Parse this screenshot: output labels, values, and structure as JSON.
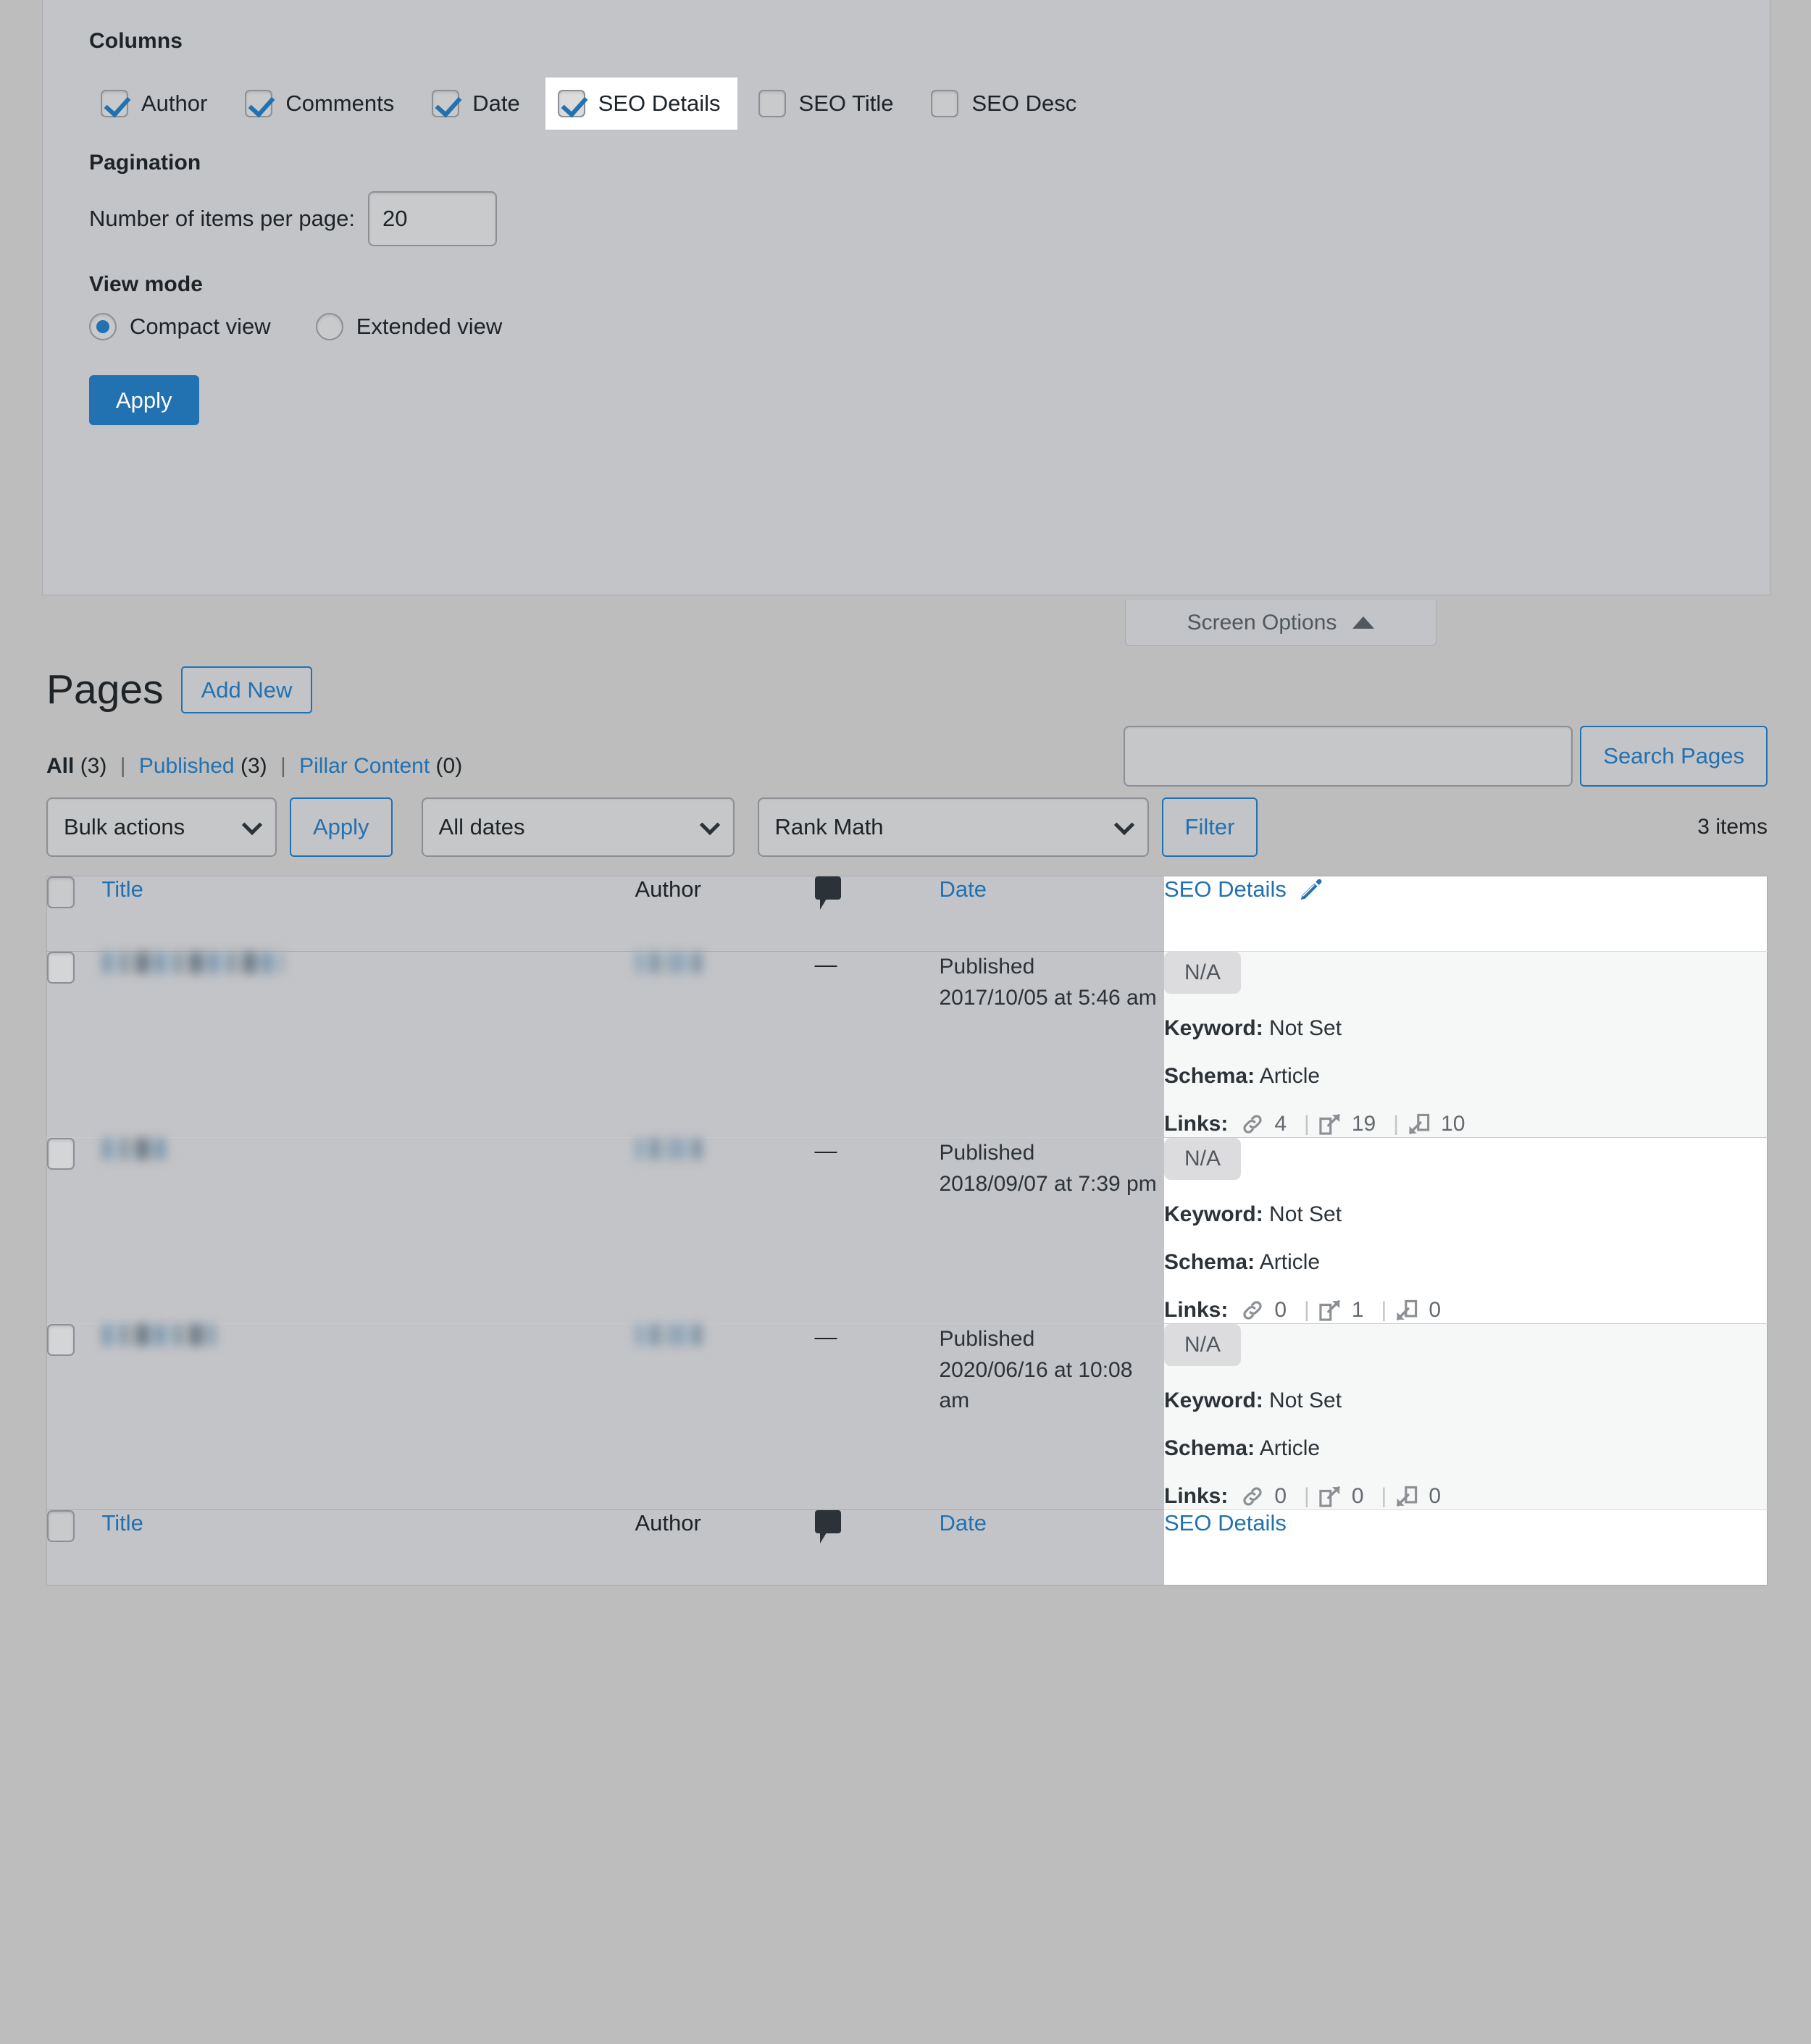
{
  "screen_options": {
    "columns_legend": "Columns",
    "columns": [
      {
        "label": "Author",
        "checked": true,
        "focused": false
      },
      {
        "label": "Comments",
        "checked": true,
        "focused": false
      },
      {
        "label": "Date",
        "checked": true,
        "focused": false
      },
      {
        "label": "SEO Details",
        "checked": true,
        "focused": true
      },
      {
        "label": "SEO Title",
        "checked": false,
        "focused": false
      },
      {
        "label": "SEO Desc",
        "checked": false,
        "focused": false
      }
    ],
    "pagination_legend": "Pagination",
    "per_page_label": "Number of items per page:",
    "per_page_value": "20",
    "view_mode_legend": "View mode",
    "view_modes": [
      {
        "label": "Compact view",
        "selected": true
      },
      {
        "label": "Extended view",
        "selected": false
      }
    ],
    "apply_label": "Apply",
    "tab_label": "Screen Options"
  },
  "header": {
    "title": "Pages",
    "add_new_label": "Add New"
  },
  "views": {
    "items": [
      {
        "label": "All",
        "count": "(3)",
        "current": true
      },
      {
        "label": "Published",
        "count": "(3)",
        "current": false
      },
      {
        "label": "Pillar Content",
        "count": "(0)",
        "current": false
      }
    ],
    "separator": "|"
  },
  "search": {
    "value": "",
    "placeholder": "",
    "button_label": "Search Pages"
  },
  "tablenav": {
    "bulk_actions_value": "Bulk actions",
    "apply_label": "Apply",
    "dates_value": "All dates",
    "rank_math_value": "Rank Math",
    "filter_label": "Filter",
    "items_count": "3 items"
  },
  "table": {
    "columns": {
      "title": "Title",
      "author": "Author",
      "comments_icon": "comment-bubble-icon",
      "date": "Date",
      "seo_details": "SEO Details",
      "seo_edit_icon": "pencil-icon"
    },
    "rows": [
      {
        "title_redacted": true,
        "author_redacted": true,
        "comments": "—",
        "date_status": "Published",
        "date_value": "2017/10/05 at 5:46 am",
        "seo": {
          "score_badge": "N/A",
          "keyword_label": "Keyword:",
          "keyword_value": "Not Set",
          "schema_label": "Schema:",
          "schema_value": "Article",
          "links_label": "Links:",
          "internal_links": "4",
          "external_links": "19",
          "incoming_links": "10"
        }
      },
      {
        "title_redacted": true,
        "author_redacted": true,
        "comments": "—",
        "date_status": "Published",
        "date_value": "2018/09/07 at 7:39 pm",
        "seo": {
          "score_badge": "N/A",
          "keyword_label": "Keyword:",
          "keyword_value": "Not Set",
          "schema_label": "Schema:",
          "schema_value": "Article",
          "links_label": "Links:",
          "internal_links": "0",
          "external_links": "1",
          "incoming_links": "0"
        }
      },
      {
        "title_redacted": true,
        "author_redacted": true,
        "comments": "—",
        "date_status": "Published",
        "date_value": "2020/06/16 at 10:08 am",
        "seo": {
          "score_badge": "N/A",
          "keyword_label": "Keyword:",
          "keyword_value": "Not Set",
          "schema_label": "Schema:",
          "schema_value": "Article",
          "links_label": "Links:",
          "internal_links": "0",
          "external_links": "0",
          "incoming_links": "0"
        }
      }
    ],
    "link_icons": {
      "internal": "chain-link-icon",
      "external": "external-link-out-icon",
      "incoming": "external-link-in-icon"
    },
    "divider": "|"
  },
  "colors": {
    "accent": "#2271b1",
    "page_bg": "#bdbdbd",
    "panel_bg": "#c3c4c7",
    "seo_cell_bg": "#ffffff",
    "seo_cell_alt_bg": "#f6f7f7",
    "badge_bg": "#dcdcde",
    "muted_text": "#646970"
  }
}
